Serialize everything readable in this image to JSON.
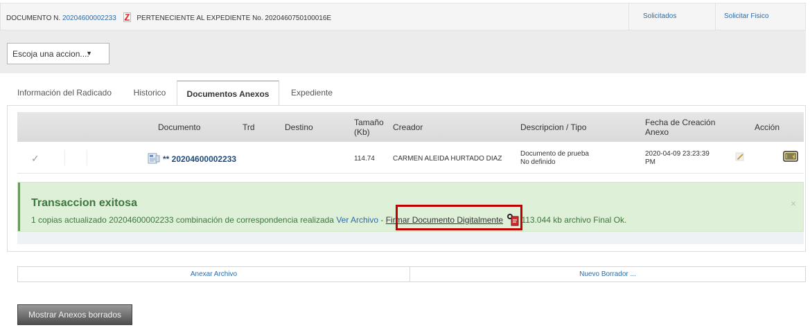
{
  "header": {
    "doc_prefix": "DOCUMENTO N.",
    "doc_number": "20204600002233",
    "expediente_text": "PERTENECIENTE AL EXPEDIENTE No. 2020460750100016E",
    "link_solicitados": "Solicitados",
    "link_solicitar_fisico": "Solicitar Fisico"
  },
  "action_select": {
    "value": "Escoja una accion....",
    "arrow": "▼"
  },
  "tabs": [
    {
      "label": "Información del Radicado",
      "active": false
    },
    {
      "label": "Historico",
      "active": false
    },
    {
      "label": "Documentos Anexos",
      "active": true
    },
    {
      "label": "Expediente",
      "active": false
    }
  ],
  "table": {
    "headers": {
      "documento": "Documento",
      "trd": "Trd",
      "destino": "Destino",
      "tamano_1": "Tamaño",
      "tamano_2": "(Kb)",
      "creador": "Creador",
      "descripcion": "Descripcion / Tipo",
      "fecha_1": "Fecha de Creación",
      "fecha_2": "Anexo",
      "accion": "Acción"
    },
    "row": {
      "check": "✓",
      "documento": "** 20204600002233",
      "tamano": "114.74",
      "creador": "CARMEN ALEIDA HURTADO DIAZ",
      "descripcion_1": "Documento de prueba",
      "descripcion_2": "No definido",
      "fecha_1": "2020-04-09 23:23:39",
      "fecha_2": "PM"
    }
  },
  "alert": {
    "title": "Transaccion exitosa",
    "msg_part1": "1 copias actualizado 20204600002233 combinación de correspondencia realizada",
    "ver_archivo": "Ver Archivo",
    "dash": " - ",
    "firmar": "Firmar Documento Digitalmente",
    "msg_part2": "113.044 kb archivo Final Ok.",
    "close": "×"
  },
  "buttons": {
    "anexar": "Anexar Archivo",
    "nuevo_borrador": "Nuevo Borrador ...",
    "mostrar_borrados": "Mostrar Anexos borrados"
  },
  "colors": {
    "link": "#2a6aa8",
    "success_text": "#3c763d",
    "success_bg": "#dff0d8",
    "highlight": "#c00000"
  }
}
